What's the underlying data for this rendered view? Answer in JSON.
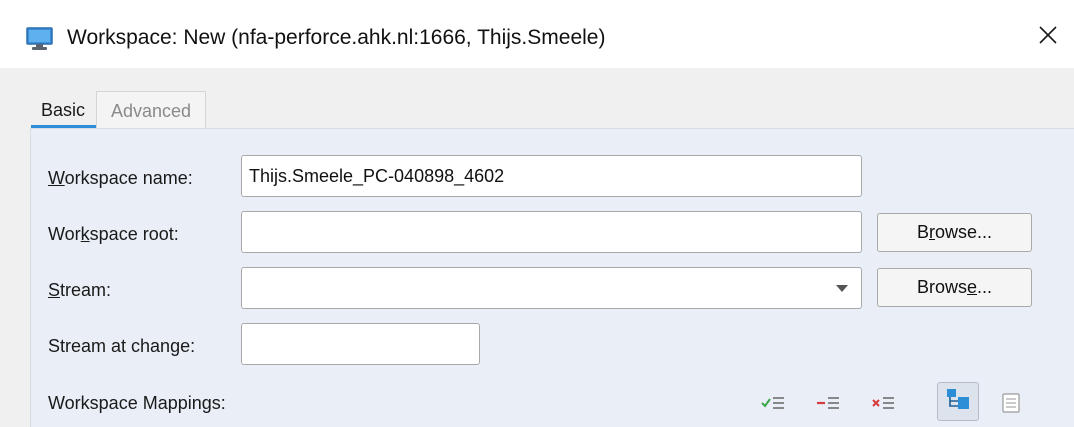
{
  "window": {
    "title": "Workspace: New (nfa-perforce.ahk.nl:1666,  Thijs.Smeele)",
    "icon": "monitor-icon",
    "close_icon": "close-icon"
  },
  "tabs": [
    {
      "label": "Basic",
      "selected": true
    },
    {
      "label": "Advanced",
      "selected": false
    }
  ],
  "form": {
    "workspace_name": {
      "label_u": "W",
      "label_rest": "orkspace name:",
      "value": "Thijs.Smeele_PC-040898_4602"
    },
    "workspace_root": {
      "label_a": "Wor",
      "label_u": "k",
      "label_b": "space root:",
      "value": "",
      "browse_label": "Browse...",
      "browse_a": "B",
      "browse_u": "r",
      "browse_b": "owse..."
    },
    "stream": {
      "label_u": "S",
      "label_rest": "tream:",
      "value": "",
      "browse_a": "Brows",
      "browse_u": "e",
      "browse_b": "...",
      "dropdown_icon": "chevron-down-icon"
    },
    "stream_at_change": {
      "label_a": "Stream at chan",
      "label_u": "g",
      "label_b": "e:",
      "value": ""
    },
    "mappings": {
      "label": "Workspace Mappings:",
      "icons": [
        "include-mapping-icon",
        "exclude-mapping-icon",
        "remove-mapping-icon",
        "tree-view-icon",
        "text-view-icon"
      ],
      "colors": {
        "include": "#3aa64a",
        "exclude": "#d63a3a",
        "remove": "#d63a3a",
        "accent": "#2b8ed6"
      }
    }
  }
}
